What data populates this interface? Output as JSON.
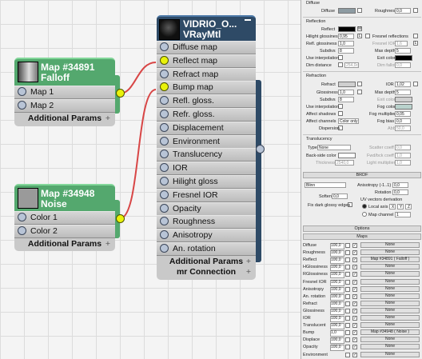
{
  "vray_node": {
    "title_line1": "VIDRIO_O...",
    "title_line2": "VRayMtl",
    "slots": [
      "Diffuse map",
      "Reflect map",
      "Refract map",
      "Bump map",
      "Refl. gloss.",
      "Refr. gloss.",
      "Displacement",
      "Environment",
      "Translucency",
      "IOR",
      "Hilight gloss",
      "Fresnel IOR",
      "Opacity",
      "Roughness",
      "Anisotropy",
      "An. rotation"
    ],
    "additional_params": "Additional Params",
    "mr_connection": "mr Connection"
  },
  "falloff_node": {
    "title_line1": "Map #34891",
    "title_line2": "Falloff",
    "slots": [
      "Map 1",
      "Map 2"
    ],
    "additional_params": "Additional Params"
  },
  "noise_node": {
    "title_line1": "Map #34948",
    "title_line2": "Noise",
    "slots": [
      "Color 1",
      "Color 2"
    ],
    "additional_params": "Additional Params"
  },
  "colors": {
    "vray_header": "#2e4a66",
    "map_header": "#54a86e",
    "link": "#d84646",
    "socket_active": "#e9f20a"
  },
  "panel": {
    "diffuse": {
      "section": "Diffuse",
      "label": "Diffuse",
      "roughness_label": "Roughness",
      "roughness_value": "0,0"
    },
    "reflection": {
      "section": "Reflection",
      "reflect": "Reflect",
      "reflect_m": "M",
      "hilight_glossiness": "Hilight glossiness",
      "hilight_value": "0,95",
      "hilight_l": "L",
      "fresnel_reflections": "Fresnel reflections",
      "refl_glossiness": "Refl. glossiness",
      "refl_gloss_value": "1,0",
      "fresnel_ior": "Fresnel IOR",
      "fresnel_ior_value": "1,6",
      "fresnel_l": "L",
      "subdivs": "Subdivs",
      "subdivs_value": "8",
      "max_depth": "Max depth",
      "max_depth_value": "5",
      "use_interpolation": "Use interpolation",
      "exit_color": "Exit color",
      "dim_distance": "Dim distance",
      "dim_distance_value": "254,0c",
      "dim_falloff": "Dim falloff",
      "dim_falloff_value": "0,0"
    },
    "refraction": {
      "section": "Refraction",
      "refract": "Refract",
      "ior": "IOR",
      "ior_value": "1,02",
      "glossiness": "Glossiness",
      "glossiness_value": "1,0",
      "max_depth": "Max depth",
      "max_depth_value": "5",
      "subdivs": "Subdivs",
      "subdivs_value": "8",
      "exit_color": "Exit color",
      "use_interpolation": "Use interpolation",
      "fog_color": "Fog color",
      "affect_shadows": "Affect shadows",
      "fog_multiplier": "Fog multiplier",
      "fog_multiplier_value": "0,05",
      "affect_channels": "Affect channels",
      "affect_channels_value": "Color only",
      "fog_bias": "Fog bias",
      "fog_bias_value": "0,0",
      "dispersion": "Dispersion",
      "abbe": "Abbe",
      "abbe_value": "50,0"
    },
    "translucency": {
      "section": "Translucency",
      "type": "Type",
      "type_value": "None",
      "scatter_coeff": "Scatter coeff",
      "scatter_value": "0,0",
      "back_side_color": "Back-side color",
      "fwd_bck_coeff": "Fwd/bck coeff",
      "fwd_value": "1,0",
      "thickness": "Thickness",
      "thickness_value": "2540,0",
      "light_multiplier": "Light multiplier",
      "light_value": "1,0"
    },
    "brdf": {
      "section": "BRDF",
      "type_value": "Blinn",
      "anisotropy": "Anisotropy (-1..1)",
      "anisotropy_value": "0,0",
      "rotation": "Rotation",
      "rotation_value": "0,0",
      "soften": "Soften",
      "soften_value": "0,0",
      "uv_vectors": "UV vectors derivation",
      "fix_dark": "Fix dark glossy edges",
      "local_axis": "Local axis",
      "axis_x": "X",
      "axis_y": "Y",
      "axis_z": "Z",
      "map_channel": "Map channel",
      "map_channel_value": "1"
    },
    "options_label": "Options",
    "maps_label": "Maps",
    "maps": [
      {
        "name": "Diffuse",
        "value": "100,0",
        "btn": "None"
      },
      {
        "name": "Roughness",
        "value": "100,0",
        "btn": "None"
      },
      {
        "name": "Reflect",
        "value": "100,0",
        "btn": "Map #34891 ( Falloff )"
      },
      {
        "name": "HGlossiness",
        "value": "100,0",
        "btn": "None"
      },
      {
        "name": "RGlossiness",
        "value": "100,0",
        "btn": "None"
      },
      {
        "name": "Fresnel IOR",
        "value": "100,0",
        "btn": "None"
      },
      {
        "name": "Anisotropy",
        "value": "100,0",
        "btn": "None"
      },
      {
        "name": "An. rotation",
        "value": "100,0",
        "btn": "None"
      },
      {
        "name": "Refract",
        "value": "100,0",
        "btn": "None"
      },
      {
        "name": "Glossiness",
        "value": "100,0",
        "btn": "None"
      },
      {
        "name": "IOR",
        "value": "100,0",
        "btn": "None"
      },
      {
        "name": "Translucent",
        "value": "100,0",
        "btn": "None"
      },
      {
        "name": "Bump",
        "value": "1,0",
        "btn": "Map #34948 ( Noise )"
      },
      {
        "name": "Displace",
        "value": "100,0",
        "btn": "None"
      },
      {
        "name": "Opacity",
        "value": "100,0",
        "btn": "None"
      },
      {
        "name": "Environment",
        "value": "",
        "btn": "None"
      }
    ]
  }
}
